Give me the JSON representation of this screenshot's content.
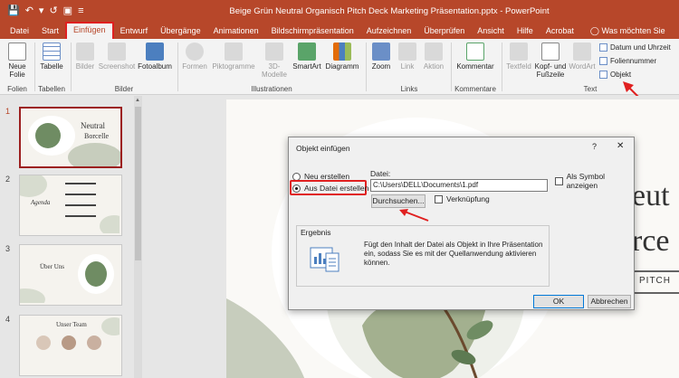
{
  "app": {
    "window_title": "Beige Grün Neutral Organisch Pitch Deck Marketing Präsentation.pptx - PowerPoint",
    "accent": "#b7472a",
    "highlight": "#e02020"
  },
  "tabs": [
    {
      "label": "Datei"
    },
    {
      "label": "Start"
    },
    {
      "label": "Einfügen"
    },
    {
      "label": "Entwurf"
    },
    {
      "label": "Übergänge"
    },
    {
      "label": "Animationen"
    },
    {
      "label": "Bildschirmpräsentation"
    },
    {
      "label": "Aufzeichnen"
    },
    {
      "label": "Überprüfen"
    },
    {
      "label": "Ansicht"
    },
    {
      "label": "Hilfe"
    },
    {
      "label": "Acrobat"
    }
  ],
  "tell_me": "Was möchten Sie tun?",
  "ribbon": {
    "neue_folie": "Neue Folie",
    "tabelle": "Tabelle",
    "bilder": "Bilder",
    "screenshot": "Screenshot",
    "fotoalbum": "Fotoalbum",
    "formen": "Formen",
    "piktogramme": "Piktogramme",
    "modelle": "3D-Modelle",
    "smartart": "SmartArt",
    "diagramm": "Diagramm",
    "zoom": "Zoom",
    "link": "Link",
    "aktion": "Aktion",
    "kommentar": "Kommentar",
    "textfeld": "Textfeld",
    "kopf_fusszeile": "Kopf- und Fußzeile",
    "wordart": "WordArt",
    "datum_uhrzeit": "Datum und Uhrzeit",
    "foliennummer": "Foliennummer",
    "objekt": "Objekt",
    "groups": {
      "folien": "Folien",
      "tabellen": "Tabellen",
      "bilder": "Bilder",
      "illustrationen": "Illustrationen",
      "links": "Links",
      "kommentare": "Kommentare",
      "text": "Text"
    }
  },
  "thumbnails": [
    {
      "num": "1",
      "title": "Neutral",
      "subtitle": "Borcelle"
    },
    {
      "num": "2",
      "title": "Agenda"
    },
    {
      "num": "3",
      "title": "Über Uns"
    },
    {
      "num": "4",
      "title": "Unser Team"
    }
  ],
  "slide": {
    "big_text_1": "eut",
    "big_text_2": "rce",
    "pitch": "PITCH"
  },
  "dialog": {
    "title": "Objekt einfügen",
    "help": "?",
    "close": "✕",
    "radio_new": "Neu erstellen",
    "radio_file": "Aus Datei erstellen",
    "file_label": "Datei:",
    "file_value": "C:\\Users\\DELL\\Documents\\1.pdf",
    "browse": "Durchsuchen...",
    "link": "Verknüpfung",
    "as_icon": "Als Symbol anzeigen",
    "result_title": "Ergebnis",
    "result_text": "Fügt den Inhalt der Datei als Objekt in Ihre Präsentation ein, sodass Sie es mit der Quellanwendung aktivieren können.",
    "ok": "OK",
    "cancel": "Abbrechen"
  }
}
